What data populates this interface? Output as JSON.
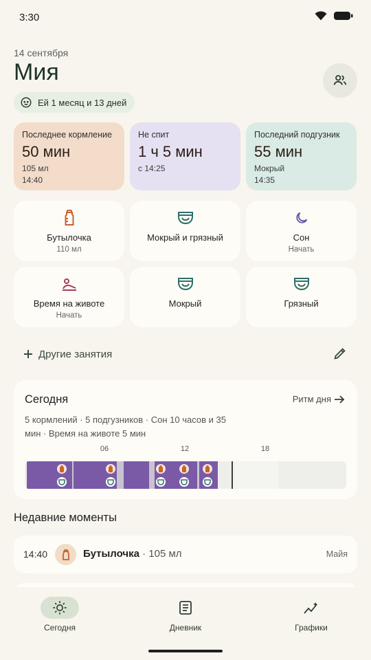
{
  "status": {
    "time": "3:30"
  },
  "header": {
    "date": "14 сентября",
    "baby_name": "Мия",
    "age": "Ей 1 месяц и 13 дней"
  },
  "summary": [
    {
      "label": "Последнее кормление",
      "value": "50 мин",
      "line1": "105 мл",
      "line2": "14:40",
      "color": "#f3dcc9"
    },
    {
      "label": "Не спит",
      "value": "1 ч 5 мин",
      "line1": "с 14:25",
      "line2": "",
      "color": "#e6e0f3"
    },
    {
      "label": "Последний подгузник",
      "value": "55 мин",
      "line1": "Мокрый",
      "line2": "14:35",
      "color": "#d9ebe4"
    }
  ],
  "actions": [
    {
      "title": "Бутылочка",
      "sub": "110 мл",
      "icon": "bottle-icon"
    },
    {
      "title": "Мокрый и грязный",
      "sub": "",
      "icon": "diaper-icon"
    },
    {
      "title": "Сон",
      "sub": "Начать",
      "icon": "moon-icon"
    },
    {
      "title": "Время на животе",
      "sub": "Начать",
      "icon": "tummy-time-icon"
    },
    {
      "title": "Мокрый",
      "sub": "",
      "icon": "diaper-icon"
    },
    {
      "title": "Грязный",
      "sub": "",
      "icon": "diaper-icon"
    }
  ],
  "other_activities": "Другие занятия",
  "today": {
    "title": "Сегодня",
    "rhythm_link": "Ритм дня",
    "summary": "5 кормлений · 5 подгузников · Сон 10 часов и 35 мин · Время на животе 5 мин",
    "ticks": [
      "06",
      "12",
      "18"
    ]
  },
  "recent": {
    "title": "Недавние моменты",
    "items": [
      {
        "time": "14:40",
        "activity": "Бутылочка",
        "detail": " · 105 мл",
        "author": "Майя",
        "icon": "bottle-icon"
      }
    ]
  },
  "nav": [
    {
      "label": "Сегодня",
      "icon": "sun-icon",
      "active": true
    },
    {
      "label": "Дневник",
      "icon": "journal-icon",
      "active": false
    },
    {
      "label": "Графики",
      "icon": "charts-icon",
      "active": false
    }
  ],
  "colors": {
    "accent": "#7a5aa6",
    "bottle": "#c9622d",
    "diaper": "#2f6e68",
    "sleep": "#6a53a1",
    "tummy": "#a33d5a"
  }
}
